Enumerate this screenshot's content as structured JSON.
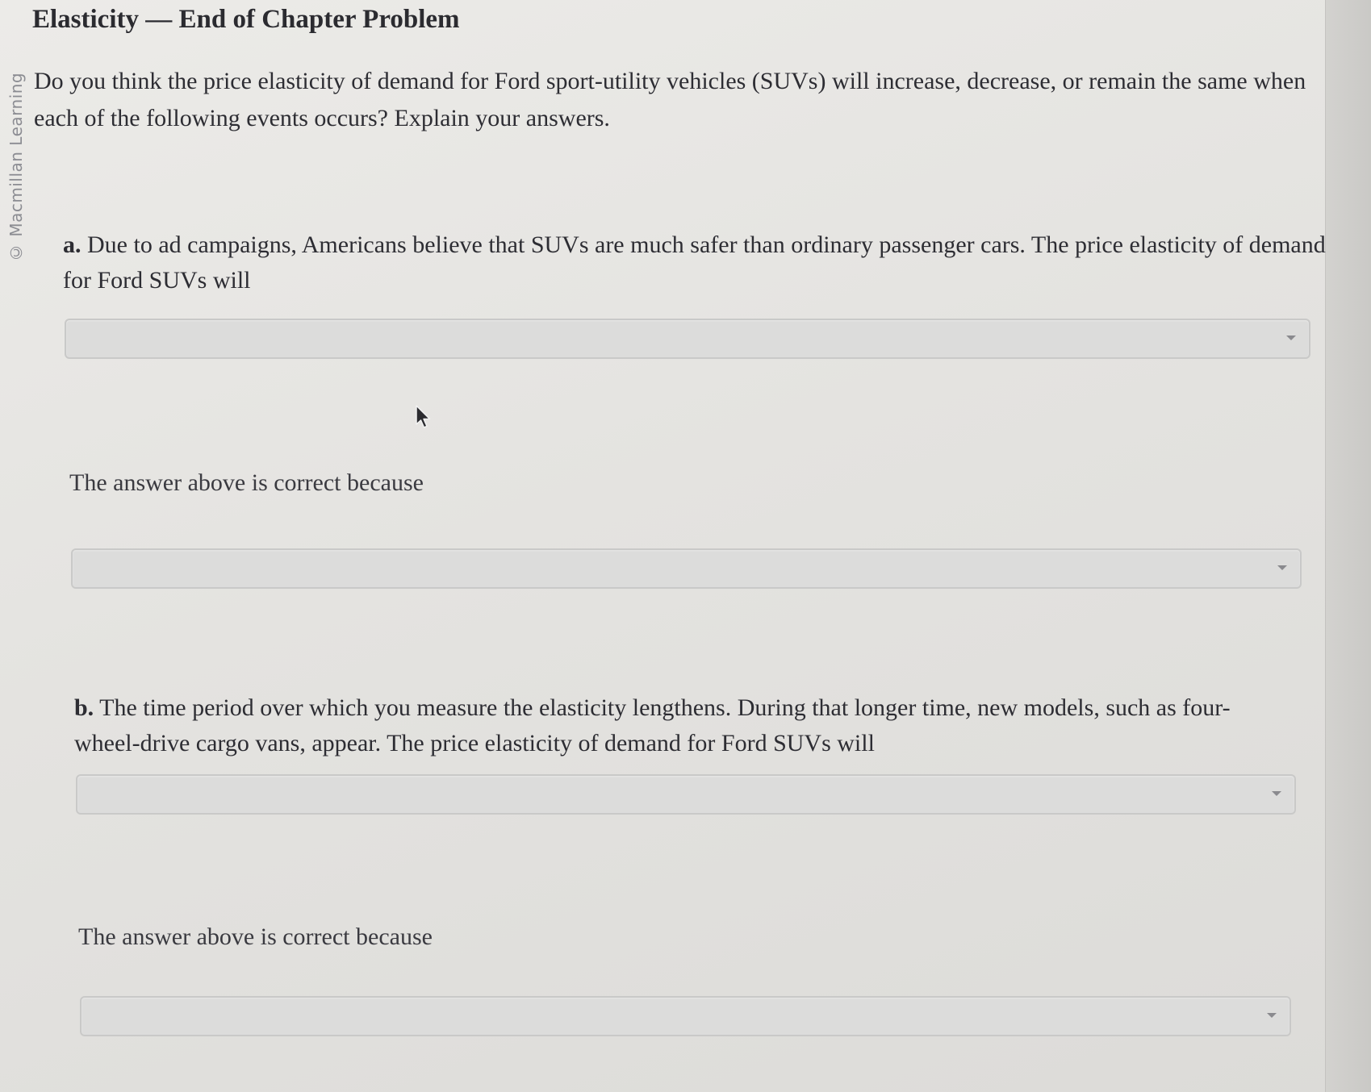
{
  "watermark": "© Macmillan Learning",
  "title": "Elasticity — End of Chapter Problem",
  "intro": "Do you think the price elasticity of demand for Ford sport-utility vehicles (SUVs) will increase, decrease, or remain the same when each of the following events occurs? Explain your answers.",
  "questions": [
    {
      "label": "a.",
      "text": " Due to ad campaigns, Americans believe that SUVs are much safer than ordinary passenger cars. The price elasticity of demand for Ford SUVs will",
      "answer_value": "",
      "because_label": "The answer above is correct because",
      "because_value": ""
    },
    {
      "label": "b.",
      "text": " The time period over which you measure the elasticity lengthens. During that longer time, new models, such as four-wheel-drive cargo vans, appear. The price elasticity of demand for Ford SUVs will",
      "answer_value": "",
      "because_label": "The answer above is correct because",
      "because_value": ""
    }
  ],
  "icons": {
    "dropdown_caret": "chevron-down-icon",
    "cursor": "mouse-pointer-icon"
  }
}
